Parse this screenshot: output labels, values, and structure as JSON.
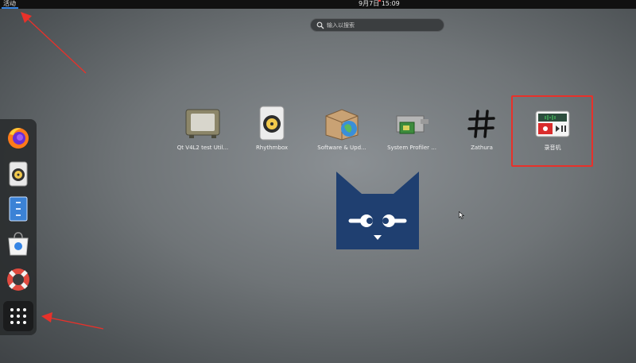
{
  "topbar": {
    "activities_label": "活动",
    "clock": "9月7日  15:09"
  },
  "search": {
    "placeholder": "输入以搜索"
  },
  "apps": [
    {
      "label": "Qt V4L2 test Util..."
    },
    {
      "label": "Rhythmbox"
    },
    {
      "label": "Software & Upd..."
    },
    {
      "label": "System Profiler ..."
    },
    {
      "label": "Zathura"
    },
    {
      "label": "录音机"
    }
  ],
  "dock": {
    "items": [
      "firefox-icon",
      "rhythmbox-icon",
      "file-cabinet-icon",
      "software-store-icon",
      "help-lifebuoy-icon",
      "show-apps-grid-icon"
    ]
  },
  "colors": {
    "highlight": "#e8312a",
    "accent": "#3584e4",
    "logo": "#1f3f70"
  }
}
